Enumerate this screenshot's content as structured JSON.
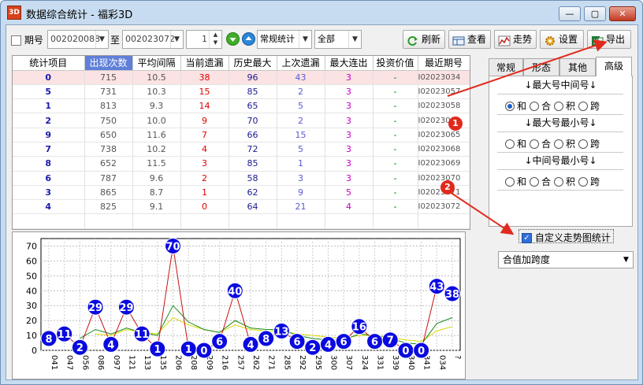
{
  "window": {
    "title": "数据综合统计 - 福彩3D",
    "icon_text": "3D",
    "controls": [
      "—",
      "▢",
      "✕"
    ]
  },
  "toolbar": {
    "period_checkbox_label": "期号",
    "period_from": "002020088",
    "to_label": "至",
    "period_to": "002023072",
    "step_value": "1",
    "stat_mode": "常规统计",
    "scope": "全部",
    "refresh_label": "刷新",
    "view_label": "查看",
    "trend_label": "走势",
    "settings_label": "设置",
    "export_label": "导出"
  },
  "table": {
    "columns": [
      "统计项目",
      "出现次数",
      "平均间隔",
      "当前遗漏",
      "历史最大",
      "上次遗漏",
      "最大连出",
      "投资价值",
      "最近期号"
    ],
    "rows": [
      {
        "item": "0",
        "count": "715",
        "avg": "10.5",
        "cur": "38",
        "hist": "96",
        "last": "43",
        "streak": "3",
        "value": "-",
        "recent": "I02023034"
      },
      {
        "item": "5",
        "count": "731",
        "avg": "10.3",
        "cur": "15",
        "hist": "85",
        "last": "2",
        "streak": "3",
        "value": "-",
        "recent": "I02023057"
      },
      {
        "item": "1",
        "count": "813",
        "avg": "9.3",
        "cur": "14",
        "hist": "65",
        "last": "5",
        "streak": "3",
        "value": "-",
        "recent": "I02023058"
      },
      {
        "item": "2",
        "count": "750",
        "avg": "10.0",
        "cur": "9",
        "hist": "70",
        "last": "2",
        "streak": "3",
        "value": "-",
        "recent": "I02023063"
      },
      {
        "item": "9",
        "count": "650",
        "avg": "11.6",
        "cur": "7",
        "hist": "66",
        "last": "15",
        "streak": "3",
        "value": "-",
        "recent": "I02023065"
      },
      {
        "item": "7",
        "count": "738",
        "avg": "10.2",
        "cur": "4",
        "hist": "72",
        "last": "5",
        "streak": "3",
        "value": "-",
        "recent": "I02023068"
      },
      {
        "item": "8",
        "count": "652",
        "avg": "11.5",
        "cur": "3",
        "hist": "85",
        "last": "1",
        "streak": "3",
        "value": "-",
        "recent": "I02023069"
      },
      {
        "item": "6",
        "count": "787",
        "avg": "9.6",
        "cur": "2",
        "hist": "58",
        "last": "3",
        "streak": "3",
        "value": "-",
        "recent": "I02023070"
      },
      {
        "item": "3",
        "count": "865",
        "avg": "8.7",
        "cur": "1",
        "hist": "62",
        "last": "9",
        "streak": "5",
        "value": "-",
        "recent": "I02023071"
      },
      {
        "item": "4",
        "count": "825",
        "avg": "9.1",
        "cur": "0",
        "hist": "64",
        "last": "21",
        "streak": "4",
        "value": "-",
        "recent": "I02023072"
      }
    ]
  },
  "side": {
    "tabs": [
      "常规",
      "形态",
      "其他",
      "高级"
    ],
    "sections": [
      {
        "title": "↓最大号中间号↓",
        "options": [
          "和",
          "合",
          "积",
          "跨"
        ],
        "selected": 0
      },
      {
        "title": "↓最大号最小号↓",
        "options": [
          "和",
          "合",
          "积",
          "跨"
        ],
        "selected": -1
      },
      {
        "title": "↓中间号最小号↓",
        "options": [
          "和",
          "合",
          "积",
          "跨"
        ],
        "selected": -1
      }
    ],
    "custom_check_label": "自定义走势图统计",
    "custom_check_mark": "✓",
    "dropdown_value": "合值加跨度"
  },
  "callouts": [
    "1",
    "2"
  ],
  "colors": {
    "accent": "#5f7fd8",
    "callout": "#e12a1e",
    "bubble": "#0a0ae0",
    "line_red": "#c81010",
    "line_green": "#1a8a1a",
    "line_yellow": "#d8d800"
  },
  "chart_data": {
    "type": "line",
    "x": [
      "041",
      "047",
      "056",
      "086",
      "097",
      "121",
      "133",
      "135",
      "206",
      "208",
      "209",
      "216",
      "257",
      "262",
      "271",
      "285",
      "292",
      "295",
      "300",
      "307",
      "324",
      "331",
      "339",
      "340",
      "341",
      "034",
      "?"
    ],
    "values": [
      8,
      11,
      2,
      29,
      4,
      29,
      11,
      1,
      70,
      1,
      0,
      6,
      40,
      4,
      8,
      13,
      6,
      2,
      4,
      6,
      16,
      6,
      7,
      0,
      0,
      43,
      38
    ],
    "series": [
      {
        "values": [
          8,
          11,
          2,
          29,
          4,
          29,
          11,
          1,
          70,
          1,
          0,
          6,
          40,
          4,
          8,
          13,
          6,
          2,
          4,
          6,
          16,
          6,
          7,
          0,
          0,
          43,
          38
        ]
      },
      {
        "values": [
          null,
          null,
          8,
          14,
          11,
          15,
          12,
          10,
          30,
          19,
          14,
          12,
          20,
          15,
          14,
          14,
          10,
          8,
          7,
          7,
          11,
          10,
          8,
          5,
          4,
          18,
          22
        ]
      },
      {
        "values": [
          null,
          null,
          null,
          11,
          10,
          14,
          12,
          11,
          22,
          17,
          14,
          12,
          17,
          14,
          13,
          13,
          11,
          10,
          9,
          8,
          10,
          10,
          9,
          7,
          6,
          13,
          16
        ]
      }
    ],
    "ylim": [
      0,
      75
    ],
    "yticks": [
      0,
      10,
      20,
      30,
      40,
      50,
      60,
      70
    ],
    "grid": true
  }
}
